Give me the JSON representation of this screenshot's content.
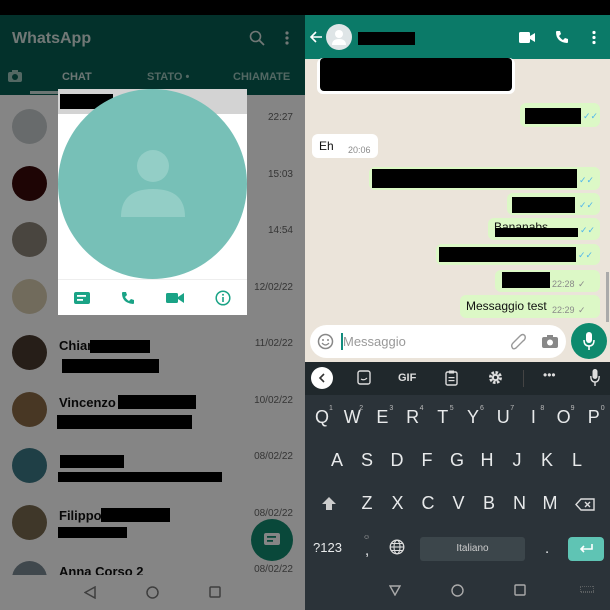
{
  "left": {
    "app_title": "WhatsApp",
    "icons": [
      "camera-icon",
      "search-icon",
      "more-vert-icon"
    ],
    "tabs": [
      {
        "label": "CHAT"
      },
      {
        "label": "STATO •"
      },
      {
        "label": "CHIAMATE"
      }
    ],
    "chats": [
      {
        "name": "",
        "time": "22:27",
        "avatar": "#c8cdd0"
      },
      {
        "name": "",
        "time": "15:03",
        "avatar": "#3a0b0b"
      },
      {
        "name": "",
        "time": "14:54",
        "avatar": "#8d857a"
      },
      {
        "name": "",
        "time": "12/02/22",
        "avatar": "#d8cdb0"
      },
      {
        "name": "Chiara",
        "time": "11/02/22",
        "avatar": "#4a3a2e"
      },
      {
        "name": "Vincenzo",
        "time": "10/02/22",
        "avatar": "#8a6a45"
      },
      {
        "name": "",
        "time": "08/02/22",
        "avatar": "#3c7a86"
      },
      {
        "name": "Filippo",
        "time": "08/02/22",
        "avatar": "#7a6a50"
      },
      {
        "name": "Anna Corso 2",
        "time": "08/02/22",
        "avatar": "#7b8a95"
      }
    ],
    "popup": {
      "actions": [
        "message-icon",
        "call-icon",
        "videocam-icon",
        "info-icon"
      ],
      "accent": "#1aa386"
    }
  },
  "right": {
    "header_icons": [
      "back-arrow-icon",
      "videocam-icon",
      "call-icon",
      "more-vert-icon"
    ],
    "messages": [
      {
        "dir": "in",
        "text": "Eh",
        "time": "20:06"
      },
      {
        "dir": "out",
        "text": "Bananabs",
        "time": ""
      },
      {
        "dir": "out",
        "text": "",
        "time": "22:28",
        "status": "✓"
      },
      {
        "dir": "out",
        "text": "Messaggio test",
        "time": "22:29",
        "status": "✓"
      }
    ],
    "read_ticks": "✓✓",
    "input_placeholder": "Messaggio",
    "keyboard": {
      "toolbar": {
        "gif": "GIF"
      },
      "row1": [
        "Q",
        "W",
        "E",
        "R",
        "T",
        "Y",
        "U",
        "I",
        "O",
        "P"
      ],
      "row1_hints": [
        "1",
        "2",
        "3",
        "4",
        "5",
        "6",
        "7",
        "8",
        "9",
        "0"
      ],
      "row2": [
        "A",
        "S",
        "D",
        "F",
        "G",
        "H",
        "J",
        "K",
        "L"
      ],
      "row3": [
        "Z",
        "X",
        "C",
        "V",
        "B",
        "N",
        "M"
      ],
      "symbols": "?123",
      "comma": ",",
      "space": "Italiano",
      "period": "."
    }
  }
}
